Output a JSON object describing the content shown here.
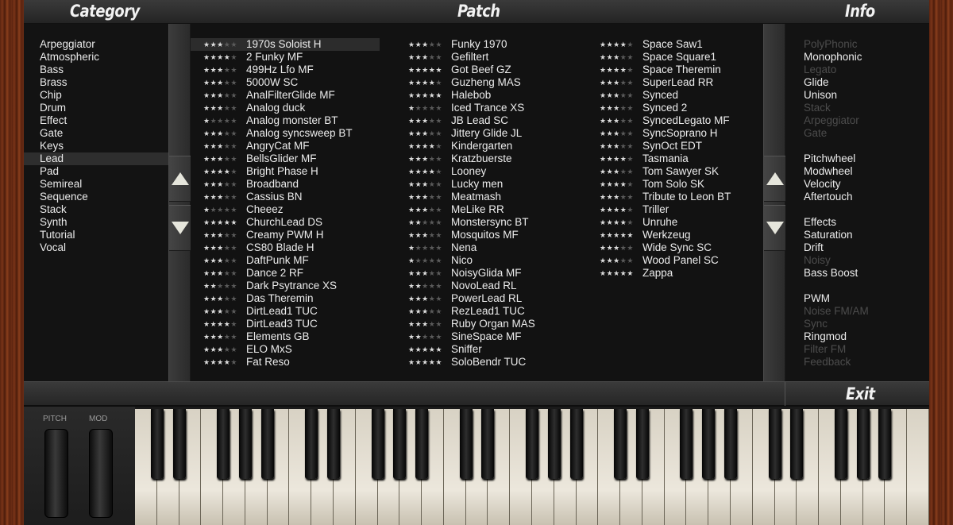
{
  "header": {
    "category": "Category",
    "patch": "Patch",
    "info": "Info"
  },
  "categories": [
    {
      "label": "Arpeggiator"
    },
    {
      "label": "Atmospheric"
    },
    {
      "label": "Bass"
    },
    {
      "label": "Brass"
    },
    {
      "label": "Chip"
    },
    {
      "label": "Drum"
    },
    {
      "label": "Effect"
    },
    {
      "label": "Gate"
    },
    {
      "label": "Keys"
    },
    {
      "label": "Lead",
      "selected": true
    },
    {
      "label": "Pad"
    },
    {
      "label": "Semireal"
    },
    {
      "label": "Sequence"
    },
    {
      "label": "Stack"
    },
    {
      "label": "Synth"
    },
    {
      "label": "Tutorial"
    },
    {
      "label": "Vocal"
    }
  ],
  "patches": {
    "col1": [
      {
        "name": "1970s Soloist H",
        "stars": 3,
        "selected": true
      },
      {
        "name": "2 Funky MF",
        "stars": 4
      },
      {
        "name": "499Hz Lfo MF",
        "stars": 3
      },
      {
        "name": "5000W SC",
        "stars": 3
      },
      {
        "name": "AnalFilterGlide MF",
        "stars": 3
      },
      {
        "name": "Analog duck",
        "stars": 3
      },
      {
        "name": "Analog monster BT",
        "stars": 1
      },
      {
        "name": "Analog syncsweep BT",
        "stars": 3
      },
      {
        "name": "AngryCat MF",
        "stars": 3
      },
      {
        "name": "BellsGlider MF",
        "stars": 3
      },
      {
        "name": "Bright Phase H",
        "stars": 4
      },
      {
        "name": "Broadband",
        "stars": 3
      },
      {
        "name": "Cassius BN",
        "stars": 3
      },
      {
        "name": "Cheeez",
        "stars": 1
      },
      {
        "name": "ChurchLead DS",
        "stars": 5
      },
      {
        "name": "Creamy PWM H",
        "stars": 3
      },
      {
        "name": "CS80 Blade H",
        "stars": 3
      },
      {
        "name": "DaftPunk MF",
        "stars": 3
      },
      {
        "name": "Dance 2 RF",
        "stars": 3
      },
      {
        "name": "Dark Psytrance XS",
        "stars": 2
      },
      {
        "name": "Das Theremin",
        "stars": 3
      },
      {
        "name": "DirtLead1 TUC",
        "stars": 3
      },
      {
        "name": "DirtLead3 TUC",
        "stars": 4
      },
      {
        "name": "Elements GB",
        "stars": 3
      },
      {
        "name": "ELO MxS",
        "stars": 3
      },
      {
        "name": "Fat Reso",
        "stars": 4
      }
    ],
    "col2": [
      {
        "name": "Funky 1970",
        "stars": 3
      },
      {
        "name": "Gefiltert",
        "stars": 3
      },
      {
        "name": "Got Beef GZ",
        "stars": 5
      },
      {
        "name": "Guzheng MAS",
        "stars": 4
      },
      {
        "name": "Halebob",
        "stars": 5
      },
      {
        "name": "Iced Trance XS",
        "stars": 1
      },
      {
        "name": "JB Lead SC",
        "stars": 3
      },
      {
        "name": "Jittery Glide JL",
        "stars": 3
      },
      {
        "name": "Kindergarten",
        "stars": 4
      },
      {
        "name": "Kratzbuerste",
        "stars": 3
      },
      {
        "name": "Looney",
        "stars": 4
      },
      {
        "name": "Lucky men",
        "stars": 3
      },
      {
        "name": "Meatmash",
        "stars": 3
      },
      {
        "name": "MeLike RR",
        "stars": 3
      },
      {
        "name": "Monstersync BT",
        "stars": 2
      },
      {
        "name": "Mosquitos MF",
        "stars": 3
      },
      {
        "name": "Nena",
        "stars": 1
      },
      {
        "name": "Nico",
        "stars": 1
      },
      {
        "name": "NoisyGlida MF",
        "stars": 3
      },
      {
        "name": "NovoLead RL",
        "stars": 2
      },
      {
        "name": "PowerLead RL",
        "stars": 3
      },
      {
        "name": "RezLead1 TUC",
        "stars": 3
      },
      {
        "name": "Ruby Organ MAS",
        "stars": 3
      },
      {
        "name": "SineSpace MF",
        "stars": 2
      },
      {
        "name": "Sniffer",
        "stars": 5
      },
      {
        "name": "SoloBendr TUC",
        "stars": 5
      }
    ],
    "col3": [
      {
        "name": "Space Saw1",
        "stars": 4
      },
      {
        "name": "Space Square1",
        "stars": 3
      },
      {
        "name": "Space Theremin",
        "stars": 4
      },
      {
        "name": "SuperLead RR",
        "stars": 3
      },
      {
        "name": "Synced",
        "stars": 3
      },
      {
        "name": "Synced 2",
        "stars": 3
      },
      {
        "name": "SyncedLegato MF",
        "stars": 3
      },
      {
        "name": "SyncSoprano H",
        "stars": 3
      },
      {
        "name": "SynOct EDT",
        "stars": 3
      },
      {
        "name": "Tasmania",
        "stars": 4
      },
      {
        "name": "Tom Sawyer SK",
        "stars": 3
      },
      {
        "name": "Tom Solo SK",
        "stars": 4
      },
      {
        "name": "Tribute to Leon BT",
        "stars": 3
      },
      {
        "name": "Triller",
        "stars": 4
      },
      {
        "name": "Unruhe",
        "stars": 4
      },
      {
        "name": "Werkzeug",
        "stars": 5
      },
      {
        "name": "Wide Sync SC",
        "stars": 3
      },
      {
        "name": "Wood Panel SC",
        "stars": 3
      },
      {
        "name": "Zappa",
        "stars": 5
      }
    ]
  },
  "info": [
    {
      "label": "PolyPhonic",
      "active": false
    },
    {
      "label": "Monophonic",
      "active": true
    },
    {
      "label": "Legato",
      "active": false
    },
    {
      "label": "Glide",
      "active": true
    },
    {
      "label": "Unison",
      "active": true
    },
    {
      "label": "Stack",
      "active": false
    },
    {
      "label": "Arpeggiator",
      "active": false
    },
    {
      "label": "Gate",
      "active": false
    },
    {
      "gap": true
    },
    {
      "label": "Pitchwheel",
      "active": true
    },
    {
      "label": "Modwheel",
      "active": true
    },
    {
      "label": "Velocity",
      "active": true
    },
    {
      "label": "Aftertouch",
      "active": true
    },
    {
      "gap": true
    },
    {
      "label": "Effects",
      "active": true
    },
    {
      "label": "Saturation",
      "active": true
    },
    {
      "label": "Drift",
      "active": true
    },
    {
      "label": "Noisy",
      "active": false
    },
    {
      "label": "Bass Boost",
      "active": true
    },
    {
      "gap": true
    },
    {
      "label": "PWM",
      "active": true
    },
    {
      "label": "Noise FM/AM",
      "active": false
    },
    {
      "label": "Sync",
      "active": false
    },
    {
      "label": "Ringmod",
      "active": true
    },
    {
      "label": "Filter FM",
      "active": false
    },
    {
      "label": "Feedback",
      "active": false
    }
  ],
  "footer": {
    "exit": "Exit"
  },
  "wheels": {
    "pitch": "PITCH",
    "mod": "MOD"
  }
}
